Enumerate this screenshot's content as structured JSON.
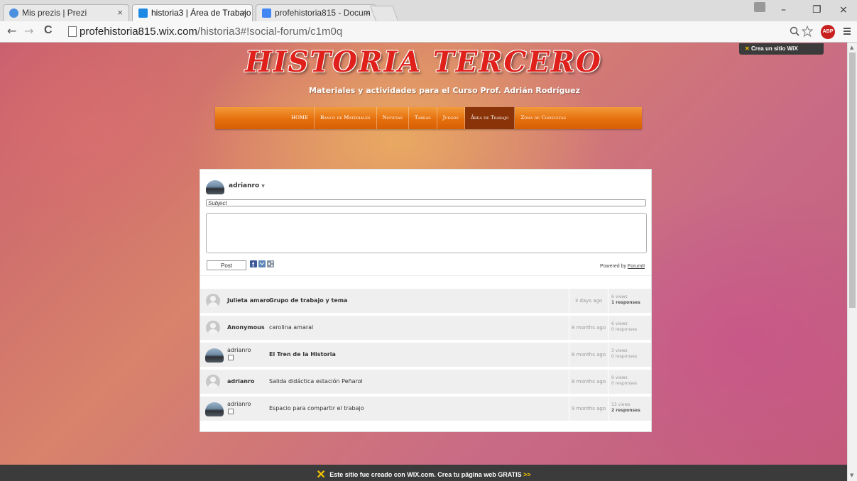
{
  "browser": {
    "tabs": [
      {
        "title": "Mis prezis | Prezi",
        "active": false,
        "favicon_color": "#4a8fe0"
      },
      {
        "title": "historia3 | Área de Trabajo",
        "active": true,
        "favicon_color": "#1e88e5"
      },
      {
        "title": "profehistoria815 - Docum",
        "active": false,
        "favicon_color": "#4285f4"
      }
    ],
    "close_glyph": "×",
    "window_controls": {
      "minimize": "–",
      "maximize": "❐",
      "close": "×"
    },
    "nav": {
      "back": "←",
      "forward": "→",
      "reload": "C"
    },
    "url_host": "profehistoria815.wix.com",
    "url_path": "/historia3#!social-forum/c1m0q",
    "extension_abp": "ABP",
    "icons": {
      "zoom": "zoom-icon",
      "star": "star-icon",
      "menu": "menu-icon"
    }
  },
  "site": {
    "title": "HISTORIA TERCERO",
    "subtitle": "Materiales y actividades para el Curso  Prof. Adrián Rodríguez",
    "menu": [
      "HOME",
      "Banco de Materiales",
      "Noticias",
      "Tareas",
      "Juegos",
      "Área de Trabajo",
      "Zona de Consultas"
    ],
    "active_menu": "Área de Trabajo",
    "wix_badge": "Crea un sitio WiX",
    "footer_text": "Este sitio fue creado con WIX.com. Crea tu página web GRATIS",
    "footer_arrows": ">>",
    "accent_colors": {
      "menu": "#e66f0c",
      "menu_active": "#8a3309",
      "title": "#e0201b",
      "wix_yellow": "#f6c600"
    }
  },
  "forum": {
    "composer": {
      "username": "adrianro",
      "dropdown_glyph": "▼",
      "subject_placeholder": "Subject",
      "post_label": "Post",
      "powered_by": "Powered by",
      "powered_link": "ForumII"
    },
    "posts": [
      {
        "user": "Julieta amaro",
        "avatar": "anon",
        "title": "Grupo de trabajo y tema",
        "bold": true,
        "date": "3 days ago",
        "views": "6 views",
        "responses": "1 responses",
        "resp_strong": true
      },
      {
        "user": "Anonymous",
        "avatar": "anon",
        "title": "carolina amaral",
        "bold": false,
        "date": "8 months ago",
        "views": "6 views",
        "responses": "0 responses",
        "resp_strong": false
      },
      {
        "user": "adrianro",
        "avatar": "user",
        "title": "El Tren de la Historia",
        "bold": true,
        "date": "8 months ago",
        "views": "3 views",
        "responses": "0 responses",
        "resp_strong": false
      },
      {
        "user": "adrianro",
        "avatar": "anon",
        "title": "Salida didáctica estación Peñarol",
        "bold": false,
        "date": "8 months ago",
        "views": "9 views",
        "responses": "0 responses",
        "resp_strong": false
      },
      {
        "user": "adrianro",
        "avatar": "user",
        "title": "Espacio para compartir el trabajo",
        "bold": false,
        "date": "9 months ago",
        "views": "13 views",
        "responses": "2 responses",
        "resp_strong": true
      }
    ]
  }
}
